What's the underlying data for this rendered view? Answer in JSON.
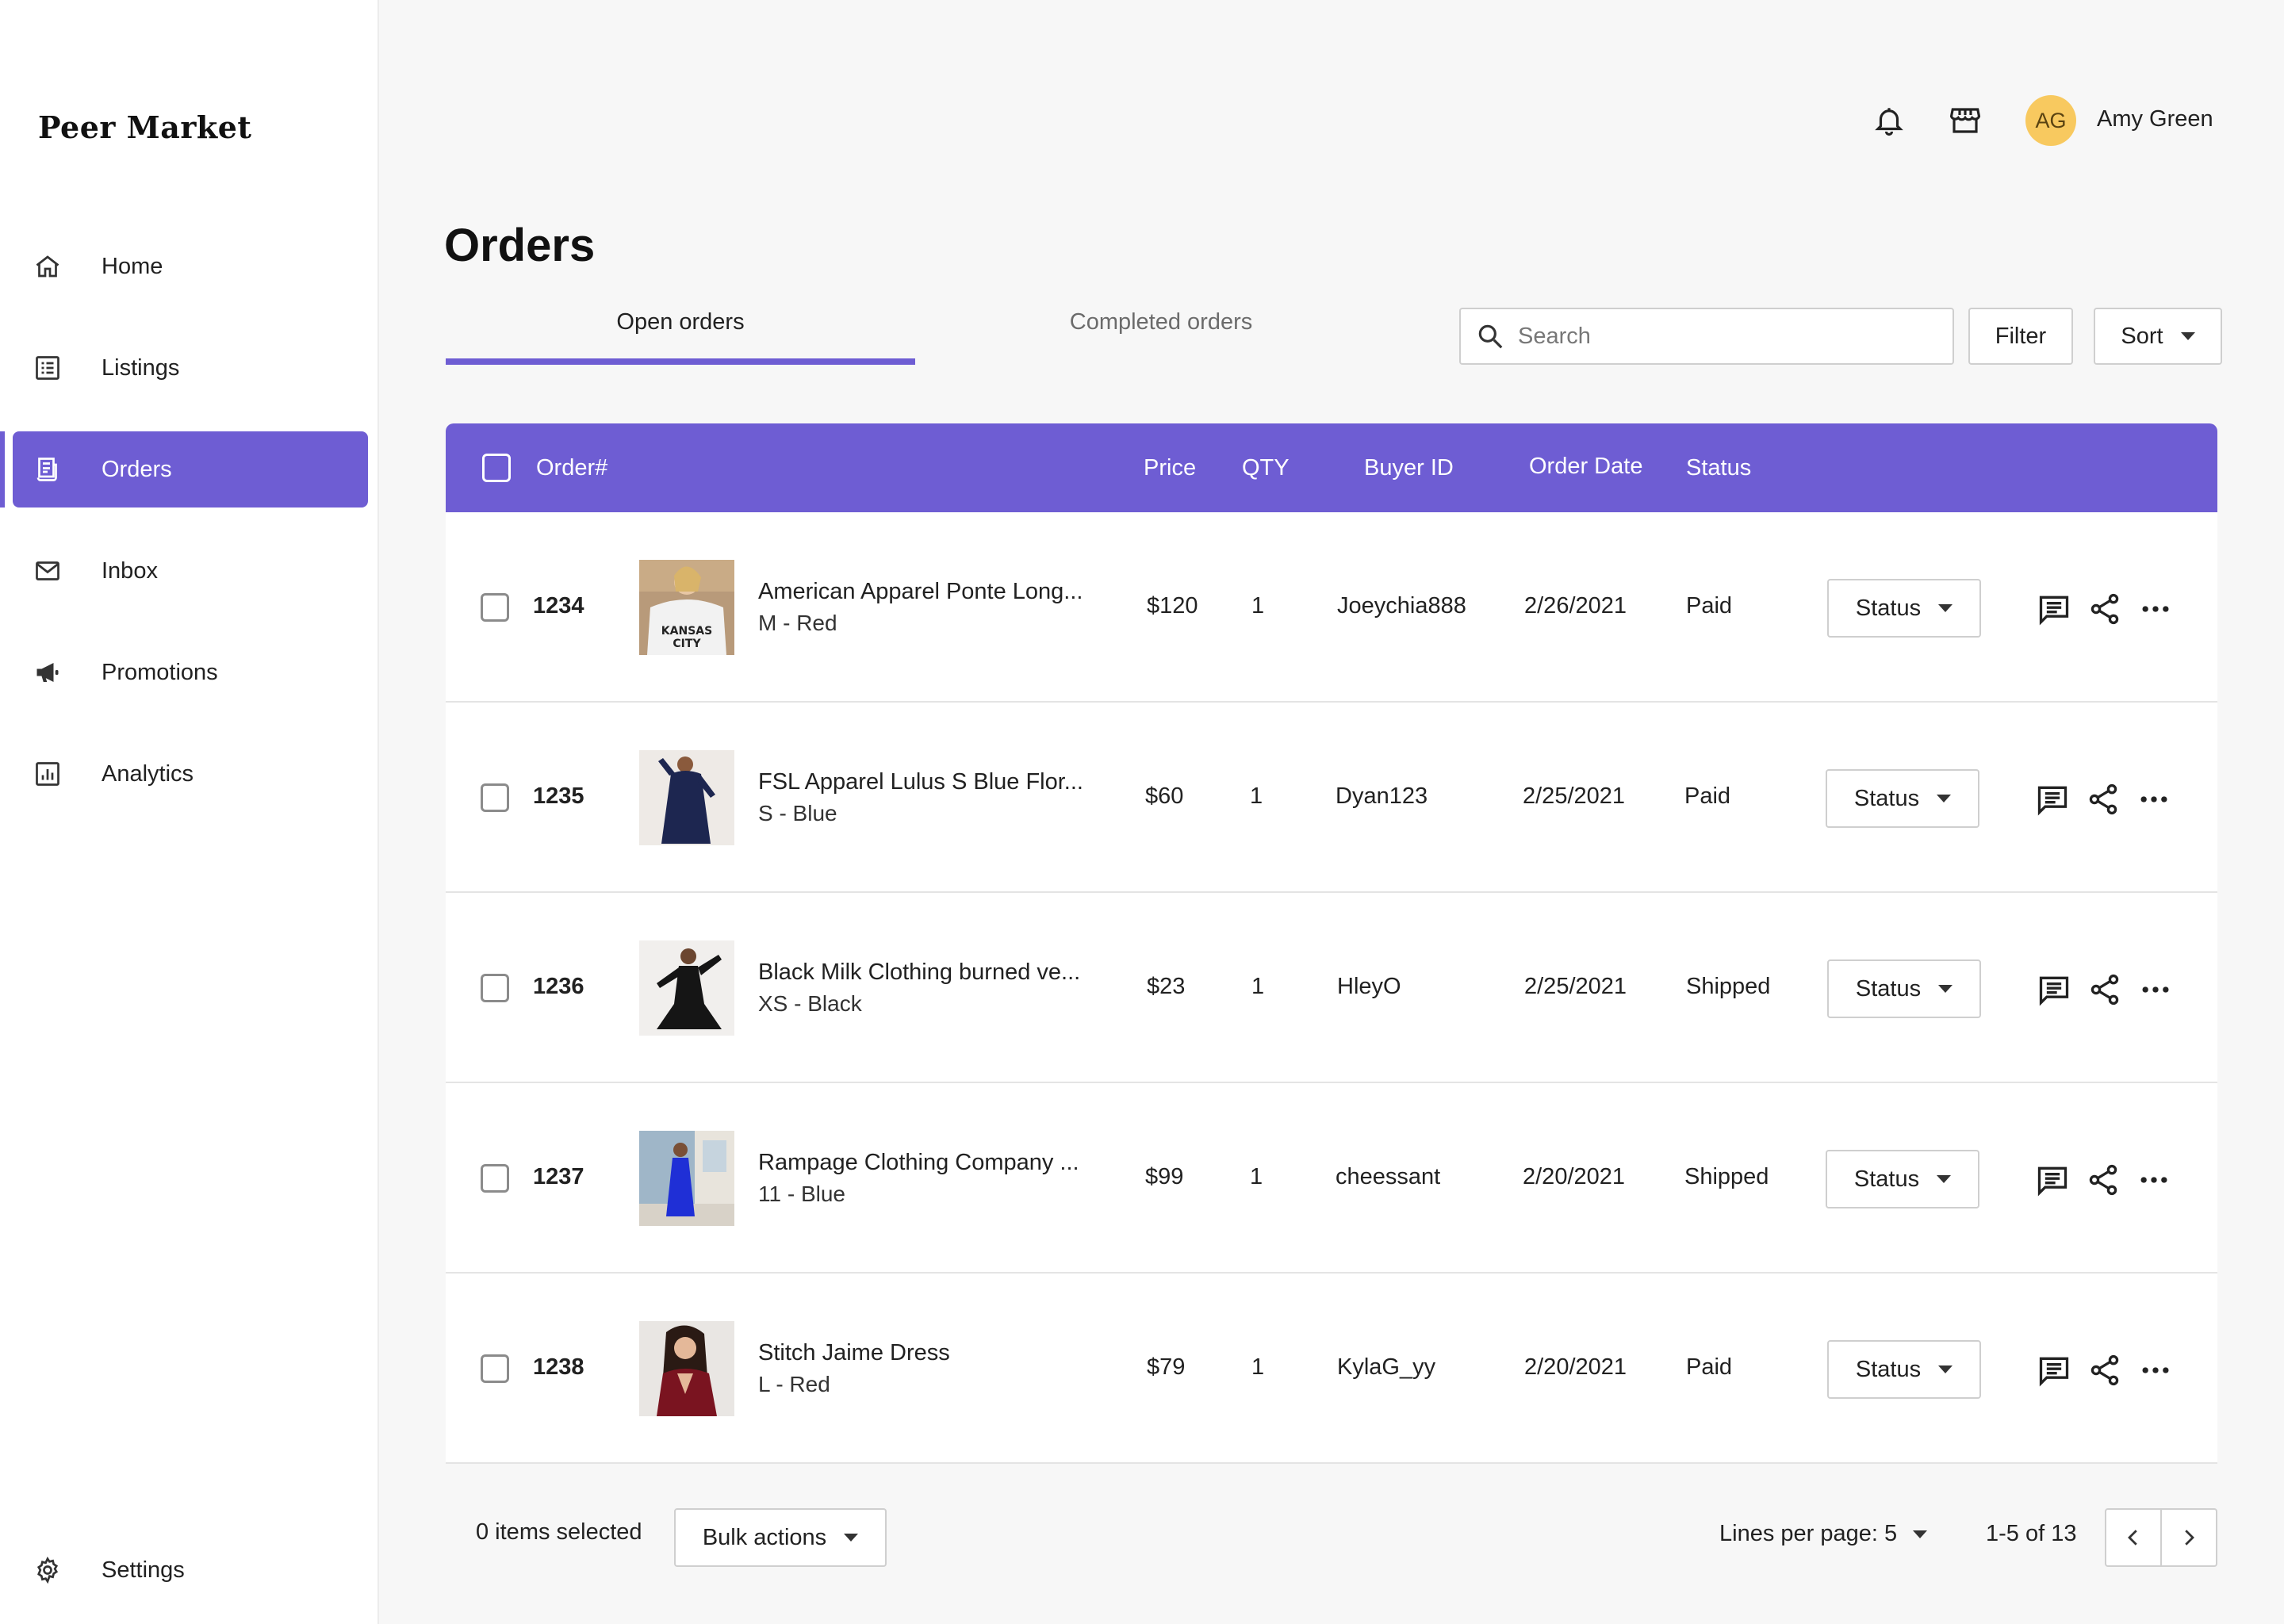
{
  "app": {
    "logo": "Peer Market"
  },
  "sidebar": {
    "items": [
      {
        "label": "Home",
        "icon": "home-icon"
      },
      {
        "label": "Listings",
        "icon": "listings-icon"
      },
      {
        "label": "Orders",
        "icon": "orders-icon",
        "active": true
      },
      {
        "label": "Inbox",
        "icon": "inbox-icon"
      },
      {
        "label": "Promotions",
        "icon": "megaphone-icon"
      },
      {
        "label": "Analytics",
        "icon": "analytics-icon"
      }
    ],
    "settings_label": "Settings"
  },
  "header": {
    "user_initials": "AG",
    "user_name": "Amy Green",
    "accent_color": "#6e5dd3",
    "avatar_color": "#f8c95f"
  },
  "page": {
    "title": "Orders",
    "tabs": [
      {
        "label": "Open orders",
        "active": true
      },
      {
        "label": "Completed orders",
        "active": false
      }
    ],
    "search_placeholder": "Search",
    "filter_label": "Filter",
    "sort_label": "Sort"
  },
  "table": {
    "columns": {
      "order": "Order#",
      "price": "Price",
      "qty": "QTY",
      "buyer": "Buyer ID",
      "date": "Order Date",
      "status": "Status"
    },
    "rows": [
      {
        "order": "1234",
        "name": "American Apparel Ponte Long...",
        "variant": "M - Red",
        "price": "$120",
        "qty": "1",
        "buyer": "Joeychia888",
        "date": "2/26/2021",
        "status": "Paid",
        "status_btn": "Status"
      },
      {
        "order": "1235",
        "name": "FSL Apparel Lulus S Blue Flor...",
        "variant": "S - Blue",
        "price": "$60",
        "qty": "1",
        "buyer": "Dyan123",
        "date": "2/25/2021",
        "status": "Paid",
        "status_btn": "Status"
      },
      {
        "order": "1236",
        "name": "Black Milk Clothing burned ve...",
        "variant": "XS - Black",
        "price": "$23",
        "qty": "1",
        "buyer": "HleyO",
        "date": "2/25/2021",
        "status": "Shipped",
        "status_btn": "Status"
      },
      {
        "order": "1237",
        "name": "Rampage Clothing Company ...",
        "variant": "11 - Blue",
        "price": "$99",
        "qty": "1",
        "buyer": "cheessant",
        "date": "2/20/2021",
        "status": "Shipped",
        "status_btn": "Status"
      },
      {
        "order": "1238",
        "name": "Stitch Jaime Dress",
        "variant": "L - Red",
        "price": "$79",
        "qty": "1",
        "buyer": "KylaG_yy",
        "date": "2/20/2021",
        "status": "Paid",
        "status_btn": "Status"
      }
    ]
  },
  "footer": {
    "items_selected": "0 items selected",
    "bulk_actions": "Bulk actions",
    "lines_per_page": "Lines per page: 5",
    "page_range": "1-5 of 13"
  }
}
